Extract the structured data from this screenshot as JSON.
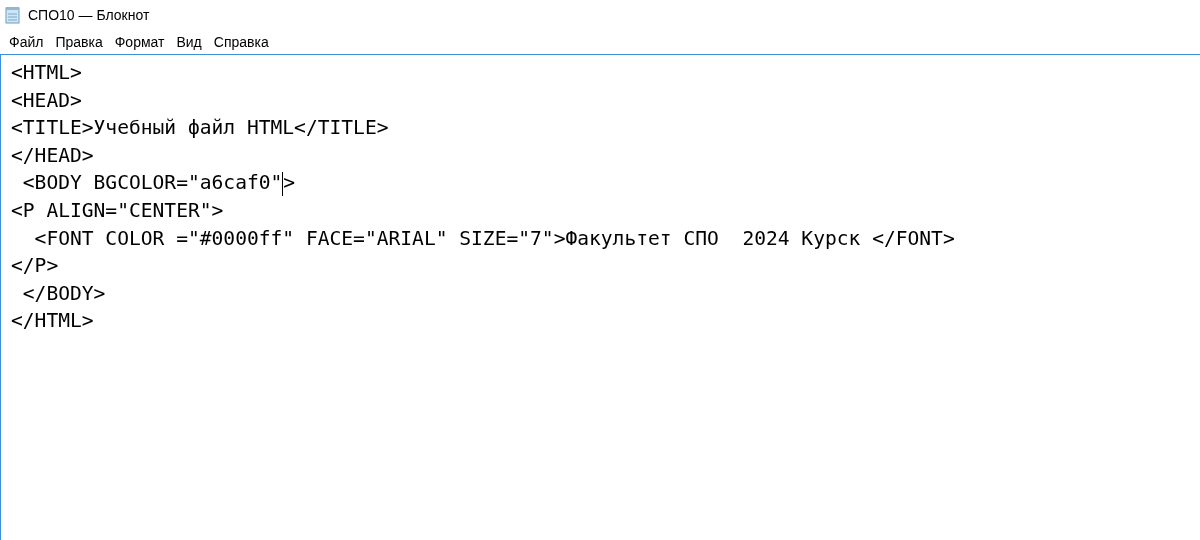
{
  "window": {
    "title": "СПО10 — Блокнот"
  },
  "menu": [
    "Файл",
    "Правка",
    "Формат",
    "Вид",
    "Справка"
  ],
  "editor": {
    "lines": [
      {
        "text": "<HTML>",
        "caret": false
      },
      {
        "text": "<HEAD>",
        "caret": false
      },
      {
        "text": "<TITLE>Учебный файл HTML</TITLE>",
        "caret": false
      },
      {
        "text": "</HEAD>",
        "caret": false
      },
      {
        "text": " <BODY BGCOLOR=\"a6caf0\"",
        "after_caret": ">",
        "caret": true
      },
      {
        "text": "<P ALIGN=\"CENTER\">",
        "caret": false
      },
      {
        "text": "  <FONT COLOR =\"#0000ff\" FACE=\"ARIAL\" SIZE=\"7\">Факультет СПО  2024 Курск </FONT>",
        "caret": false
      },
      {
        "text": "</P>",
        "caret": false
      },
      {
        "text": " </BODY>",
        "caret": false
      },
      {
        "text": "</HTML>",
        "caret": false
      }
    ]
  }
}
